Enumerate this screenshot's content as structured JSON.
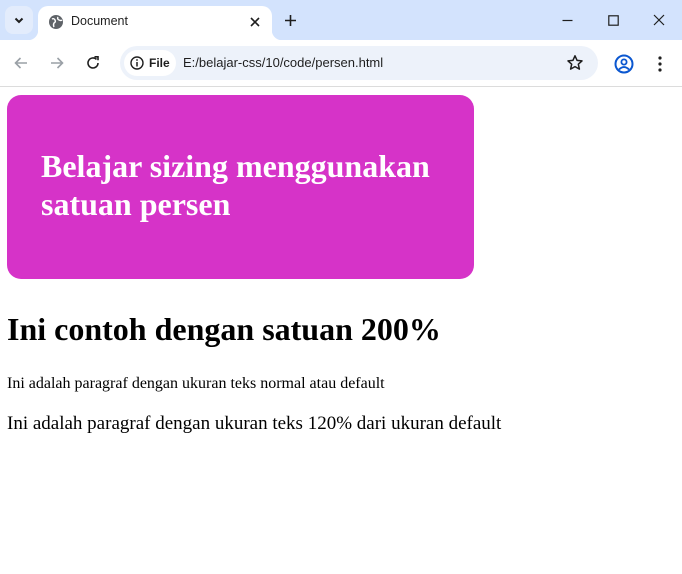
{
  "browser": {
    "tab": {
      "title": "Document",
      "favicon": "globe-icon"
    },
    "address_bar": {
      "scheme_chip": "File",
      "url": "E:/belajar-css/10/code/persen.html"
    },
    "icons": {
      "tab_search": "chevron-down-icon",
      "close_tab": "close-icon",
      "new_tab": "plus-icon",
      "minimize": "minimize-icon",
      "maximize": "maximize-icon",
      "close_window": "close-icon",
      "back": "arrow-left-icon",
      "forward": "arrow-right-icon",
      "reload": "reload-icon",
      "site_info": "info-icon",
      "bookmark": "star-icon",
      "profile": "profile-icon",
      "menu": "kebab-menu-icon"
    },
    "colors": {
      "tab_strip": "#d3e3fd",
      "omnibox": "#edf2fa"
    }
  },
  "page": {
    "banner": {
      "title": "Belajar sizing menggunakan satuan persen",
      "background": "#d633c8"
    },
    "heading": "Ini contoh dengan satuan 200%",
    "paragraph_normal": "Ini adalah paragraf dengan ukuran teks normal atau default",
    "paragraph_large": "Ini adalah paragraf dengan ukuran teks 120% dari ukuran default"
  }
}
